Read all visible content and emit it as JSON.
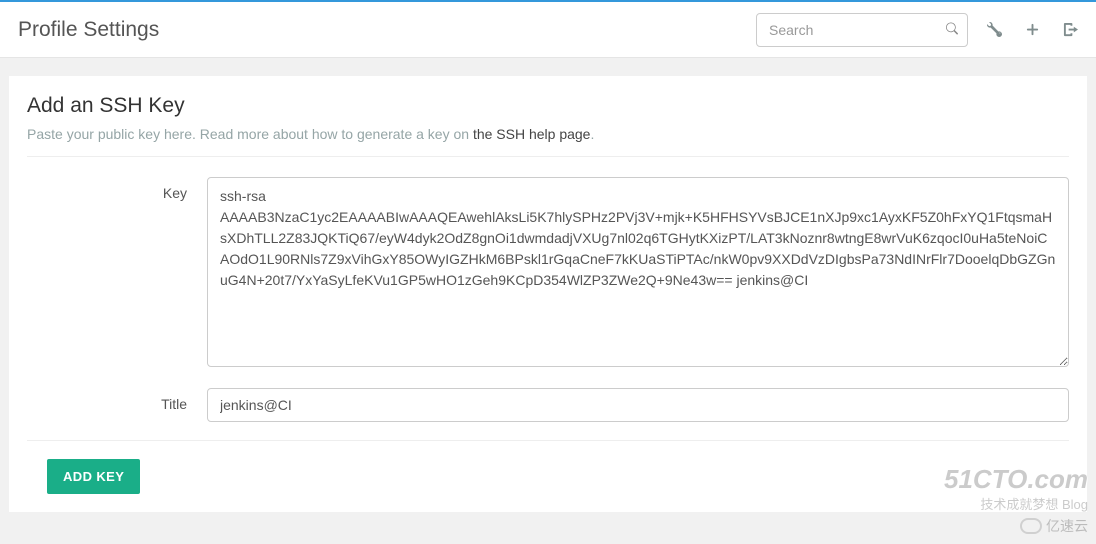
{
  "header": {
    "title": "Profile Settings",
    "search_placeholder": "Search"
  },
  "panel": {
    "title": "Add an SSH Key",
    "help_prefix": "Paste your public key here. Read more about how to generate a key on ",
    "help_link_text": "the SSH help page",
    "help_suffix": "."
  },
  "form": {
    "key_label": "Key",
    "key_value": "ssh-rsa AAAAB3NzaC1yc2EAAAABIwAAAQEAwehlAksLi5K7hlySPHz2PVj3V+mjk+K5HFHSYVsBJCE1nXJp9xc1AyxKF5Z0hFxYQ1FtqsmaHsXDhTLL2Z83JQKTiQ67/eyW4dyk2OdZ8gnOi1dwmdadjVXUg7nl02q6TGHytKXizPT/LAT3kNoznr8wtngE8wrVuK6zqocI0uHa5teNoiCAOdO1L90RNls7Z9xVihGxY85OWyIGZHkM6BPskl1rGqaCneF7kKUaSTiPTAc/nkW0pv9XXDdVzDIgbsPa73NdINrFlr7DooelqDbGZGnuG4N+20t7/YxYaSyLfeKVu1GP5wHO1zGeh9KCpD354WlZP3ZWe2Q+9Ne43w== jenkins@CI",
    "title_label": "Title",
    "title_value": "jenkins@CI",
    "submit_label": "ADD KEY"
  },
  "watermark": {
    "main": "51CTO.com",
    "sub": "技术成就梦想  Blog",
    "bottom": "亿速云"
  }
}
